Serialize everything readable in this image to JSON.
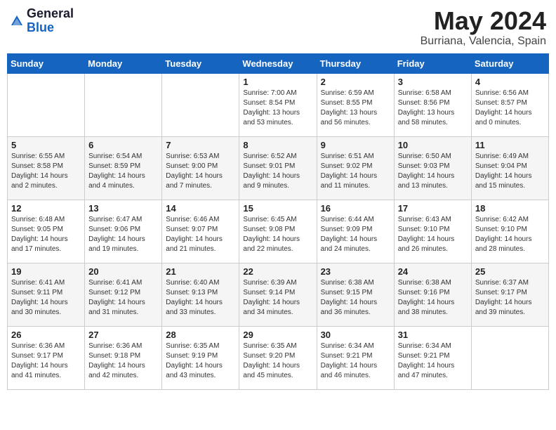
{
  "header": {
    "logo_general": "General",
    "logo_blue": "Blue",
    "title": "May 2024",
    "location": "Burriana, Valencia, Spain"
  },
  "days_of_week": [
    "Sunday",
    "Monday",
    "Tuesday",
    "Wednesday",
    "Thursday",
    "Friday",
    "Saturday"
  ],
  "weeks": [
    [
      {
        "day": "",
        "info": ""
      },
      {
        "day": "",
        "info": ""
      },
      {
        "day": "",
        "info": ""
      },
      {
        "day": "1",
        "info": "Sunrise: 7:00 AM\nSunset: 8:54 PM\nDaylight: 13 hours\nand 53 minutes."
      },
      {
        "day": "2",
        "info": "Sunrise: 6:59 AM\nSunset: 8:55 PM\nDaylight: 13 hours\nand 56 minutes."
      },
      {
        "day": "3",
        "info": "Sunrise: 6:58 AM\nSunset: 8:56 PM\nDaylight: 13 hours\nand 58 minutes."
      },
      {
        "day": "4",
        "info": "Sunrise: 6:56 AM\nSunset: 8:57 PM\nDaylight: 14 hours\nand 0 minutes."
      }
    ],
    [
      {
        "day": "5",
        "info": "Sunrise: 6:55 AM\nSunset: 8:58 PM\nDaylight: 14 hours\nand 2 minutes."
      },
      {
        "day": "6",
        "info": "Sunrise: 6:54 AM\nSunset: 8:59 PM\nDaylight: 14 hours\nand 4 minutes."
      },
      {
        "day": "7",
        "info": "Sunrise: 6:53 AM\nSunset: 9:00 PM\nDaylight: 14 hours\nand 7 minutes."
      },
      {
        "day": "8",
        "info": "Sunrise: 6:52 AM\nSunset: 9:01 PM\nDaylight: 14 hours\nand 9 minutes."
      },
      {
        "day": "9",
        "info": "Sunrise: 6:51 AM\nSunset: 9:02 PM\nDaylight: 14 hours\nand 11 minutes."
      },
      {
        "day": "10",
        "info": "Sunrise: 6:50 AM\nSunset: 9:03 PM\nDaylight: 14 hours\nand 13 minutes."
      },
      {
        "day": "11",
        "info": "Sunrise: 6:49 AM\nSunset: 9:04 PM\nDaylight: 14 hours\nand 15 minutes."
      }
    ],
    [
      {
        "day": "12",
        "info": "Sunrise: 6:48 AM\nSunset: 9:05 PM\nDaylight: 14 hours\nand 17 minutes."
      },
      {
        "day": "13",
        "info": "Sunrise: 6:47 AM\nSunset: 9:06 PM\nDaylight: 14 hours\nand 19 minutes."
      },
      {
        "day": "14",
        "info": "Sunrise: 6:46 AM\nSunset: 9:07 PM\nDaylight: 14 hours\nand 21 minutes."
      },
      {
        "day": "15",
        "info": "Sunrise: 6:45 AM\nSunset: 9:08 PM\nDaylight: 14 hours\nand 22 minutes."
      },
      {
        "day": "16",
        "info": "Sunrise: 6:44 AM\nSunset: 9:09 PM\nDaylight: 14 hours\nand 24 minutes."
      },
      {
        "day": "17",
        "info": "Sunrise: 6:43 AM\nSunset: 9:10 PM\nDaylight: 14 hours\nand 26 minutes."
      },
      {
        "day": "18",
        "info": "Sunrise: 6:42 AM\nSunset: 9:10 PM\nDaylight: 14 hours\nand 28 minutes."
      }
    ],
    [
      {
        "day": "19",
        "info": "Sunrise: 6:41 AM\nSunset: 9:11 PM\nDaylight: 14 hours\nand 30 minutes."
      },
      {
        "day": "20",
        "info": "Sunrise: 6:41 AM\nSunset: 9:12 PM\nDaylight: 14 hours\nand 31 minutes."
      },
      {
        "day": "21",
        "info": "Sunrise: 6:40 AM\nSunset: 9:13 PM\nDaylight: 14 hours\nand 33 minutes."
      },
      {
        "day": "22",
        "info": "Sunrise: 6:39 AM\nSunset: 9:14 PM\nDaylight: 14 hours\nand 34 minutes."
      },
      {
        "day": "23",
        "info": "Sunrise: 6:38 AM\nSunset: 9:15 PM\nDaylight: 14 hours\nand 36 minutes."
      },
      {
        "day": "24",
        "info": "Sunrise: 6:38 AM\nSunset: 9:16 PM\nDaylight: 14 hours\nand 38 minutes."
      },
      {
        "day": "25",
        "info": "Sunrise: 6:37 AM\nSunset: 9:17 PM\nDaylight: 14 hours\nand 39 minutes."
      }
    ],
    [
      {
        "day": "26",
        "info": "Sunrise: 6:36 AM\nSunset: 9:17 PM\nDaylight: 14 hours\nand 41 minutes."
      },
      {
        "day": "27",
        "info": "Sunrise: 6:36 AM\nSunset: 9:18 PM\nDaylight: 14 hours\nand 42 minutes."
      },
      {
        "day": "28",
        "info": "Sunrise: 6:35 AM\nSunset: 9:19 PM\nDaylight: 14 hours\nand 43 minutes."
      },
      {
        "day": "29",
        "info": "Sunrise: 6:35 AM\nSunset: 9:20 PM\nDaylight: 14 hours\nand 45 minutes."
      },
      {
        "day": "30",
        "info": "Sunrise: 6:34 AM\nSunset: 9:21 PM\nDaylight: 14 hours\nand 46 minutes."
      },
      {
        "day": "31",
        "info": "Sunrise: 6:34 AM\nSunset: 9:21 PM\nDaylight: 14 hours\nand 47 minutes."
      },
      {
        "day": "",
        "info": ""
      }
    ]
  ]
}
